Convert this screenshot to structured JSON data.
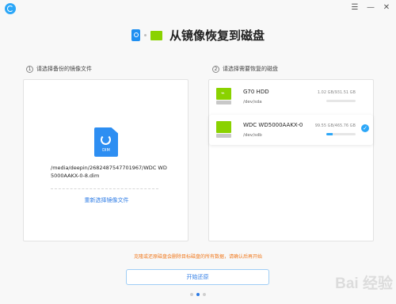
{
  "titlebar": {
    "app_icon": "deepin-logo-icon",
    "buttons": [
      {
        "name": "menu",
        "glyph": "☰"
      },
      {
        "name": "minimize",
        "glyph": "—"
      },
      {
        "name": "close",
        "glyph": "✕"
      }
    ]
  },
  "header": {
    "title": "从镜像恢复到磁盘"
  },
  "left": {
    "step_number": "1",
    "step_label": "请选择备份的镜像文件",
    "file_ext": "DIM",
    "file_path": "/media/deepin/2682487547701967/WDC WD5000AAKX-0-8.dim",
    "reselect_label": "重新选择镜像文件"
  },
  "right": {
    "step_number": "2",
    "step_label": "请选择需要恢复的磁盘",
    "disks": [
      {
        "name": "G70 HDD",
        "device": "/dev/sda",
        "size": "1.02 GB/931.51 GB",
        "usage_percent": 0.1,
        "selected": false
      },
      {
        "name": "WDC WD5000AAKX-0",
        "device": "/dev/sdb",
        "size": "99.55 GB/465.76 GB",
        "usage_percent": 21.4,
        "selected": true
      }
    ]
  },
  "warning": "克隆或还原磁盘会删除目标磁盘的所有数据，请确认后再开始",
  "start_button": "开始还原",
  "pager": {
    "count": 3,
    "active": 1
  },
  "watermark": "Bai 经验",
  "colors": {
    "accent": "#2c7be5",
    "disk_green": "#8ad200",
    "warning": "#f07a20"
  }
}
